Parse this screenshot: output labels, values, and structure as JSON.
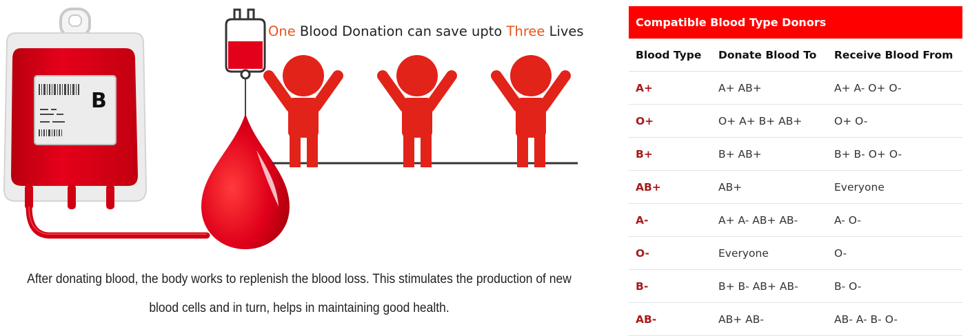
{
  "illustration": {
    "headline_parts": [
      {
        "text": "One",
        "color": "#e8541c"
      },
      {
        "text": " Blood Donation can save upto ",
        "color": "#222222"
      },
      {
        "text": "Three",
        "color": "#e8541c"
      },
      {
        "text": " Lives",
        "color": "#222222"
      }
    ],
    "bag_label": "B",
    "blood_color": "#e3001b",
    "figure_color": "#e2231a"
  },
  "caption": {
    "line1": "After donating blood, the body works to replenish the blood loss. This stimulates the production of new",
    "line2": "blood cells and in turn, helps in maintaining good health."
  },
  "table": {
    "title": "Compatible Blood Type Donors",
    "header_color": "#ff0000",
    "columns": [
      "Blood Type",
      "Donate Blood To",
      "Receive Blood From"
    ],
    "rows": [
      [
        "A+",
        "A+ AB+",
        "A+ A- O+ O-"
      ],
      [
        "O+",
        "O+ A+ B+ AB+",
        "O+ O-"
      ],
      [
        "B+",
        "B+ AB+",
        "B+ B- O+ O-"
      ],
      [
        "AB+",
        "AB+",
        "Everyone"
      ],
      [
        "A-",
        "A+ A- AB+ AB-",
        "A- O-"
      ],
      [
        "O-",
        "Everyone",
        "O-"
      ],
      [
        "B-",
        "B+ B- AB+ AB-",
        "B- O-"
      ],
      [
        "AB-",
        "AB+ AB-",
        "AB- A- B- O-"
      ]
    ]
  }
}
